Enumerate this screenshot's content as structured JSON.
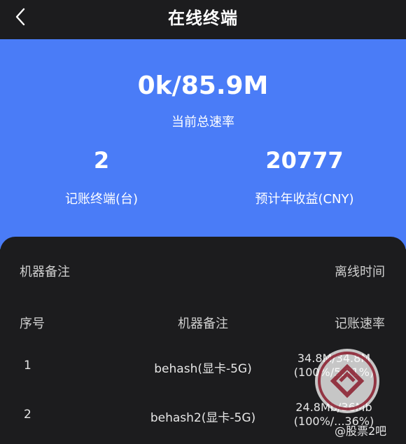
{
  "header": {
    "title": "在线终端",
    "back_icon": "chevron-left-icon"
  },
  "hero": {
    "total_speed": "0k/85.9M",
    "total_speed_label": "当前总速率",
    "terminals_value": "2",
    "terminals_label": "记账终端(台)",
    "income_value": "20777",
    "income_label": "预计年收益(CNY)",
    "accent_color": "#4a7cf7"
  },
  "sort": {
    "left_label": "机器备注",
    "right_label": "离线时间"
  },
  "table": {
    "headers": [
      "序号",
      "机器备注",
      "记账速率"
    ],
    "rows": [
      {
        "index": "1",
        "note": "behash(显卡-5G)",
        "rate_line1": "34.8M/34.8M",
        "rate_line2": "(100%/5.71%)"
      },
      {
        "index": "2",
        "note": "behash2(显卡-5G)",
        "rate_line1": "24.8Mb/36Mb",
        "rate_line2": "(100%/...36%)"
      }
    ]
  },
  "watermark": {
    "text": "@股票2吧",
    "logo_text": "股票吧"
  }
}
